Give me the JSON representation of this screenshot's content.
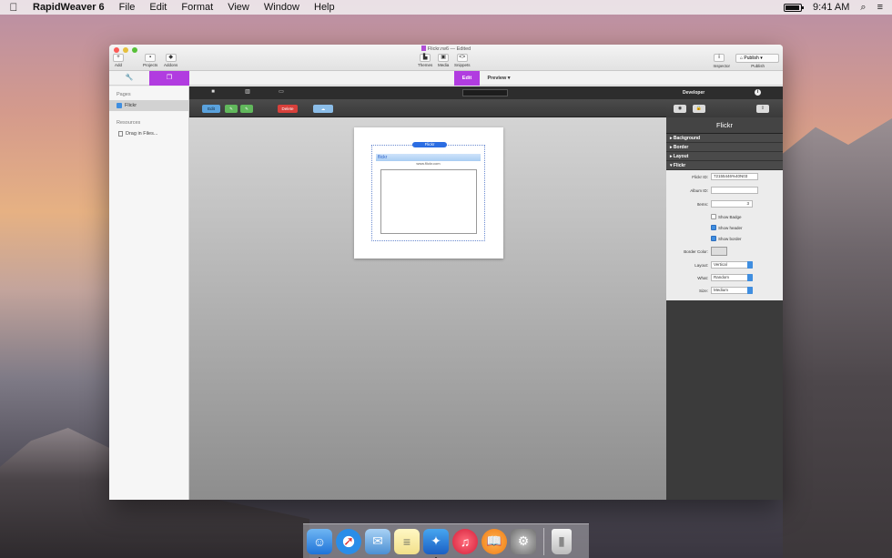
{
  "menubar": {
    "app_name": "RapidWeaver 6",
    "menus": [
      "File",
      "Edit",
      "Format",
      "View",
      "Window",
      "Help"
    ],
    "time": "9:41 AM"
  },
  "window": {
    "title": "Flickr.rw6",
    "edited": "Edited",
    "toolbar": {
      "add": "Add",
      "projects": "Projects",
      "addons": "Addons",
      "themes": "Themes",
      "media": "Media",
      "snippets": "Snippets",
      "inspector": "Inspector",
      "publish_button": "Publish",
      "publish_label": "Publish"
    },
    "modes": {
      "edit": "Edit",
      "preview": "Preview"
    }
  },
  "sidebar": {
    "pages_heading": "Pages",
    "selected_page": "Flickr",
    "resources_heading": "Resources",
    "drag_in_files": "Drag in Files..."
  },
  "editor": {
    "buttons": {
      "edit": "Edit",
      "delete": "Delete"
    },
    "widget": {
      "tag": "Flickr",
      "header": "flickr",
      "url": "www.flickr.com"
    }
  },
  "inspector": {
    "header_label": "Developer",
    "title": "Flickr",
    "sections": [
      "Background",
      "Border",
      "Layout",
      "Flickr"
    ],
    "fields": {
      "flickr_id_label": "Flickr ID:",
      "flickr_id_value": "72155446%40N03",
      "album_id_label": "Album ID:",
      "album_id_value": "",
      "items_label": "Items:",
      "items_value": "3",
      "show_badge": "Show Badge",
      "show_header": "Show header",
      "show_border": "Show border",
      "border_color_label": "Border Color:",
      "layout_label": "Layout:",
      "layout_value": "Vertical",
      "what_label": "What:",
      "what_value": "Random",
      "size_label": "Size:",
      "size_value": "Medium"
    },
    "checkbox_states": {
      "show_badge": false,
      "show_header": true,
      "show_border": true
    },
    "accent": "#3f8ee0"
  },
  "dock": {
    "apps": [
      "finder-icon",
      "safari-icon",
      "preview-icon",
      "notes-icon",
      "rapidweaver-icon",
      "itunes-icon",
      "ibooks-icon",
      "system-preferences-icon",
      "trash-icon"
    ]
  },
  "colors": {
    "brand_purple": "#b13ce0",
    "delete_red": "#d8403b"
  }
}
